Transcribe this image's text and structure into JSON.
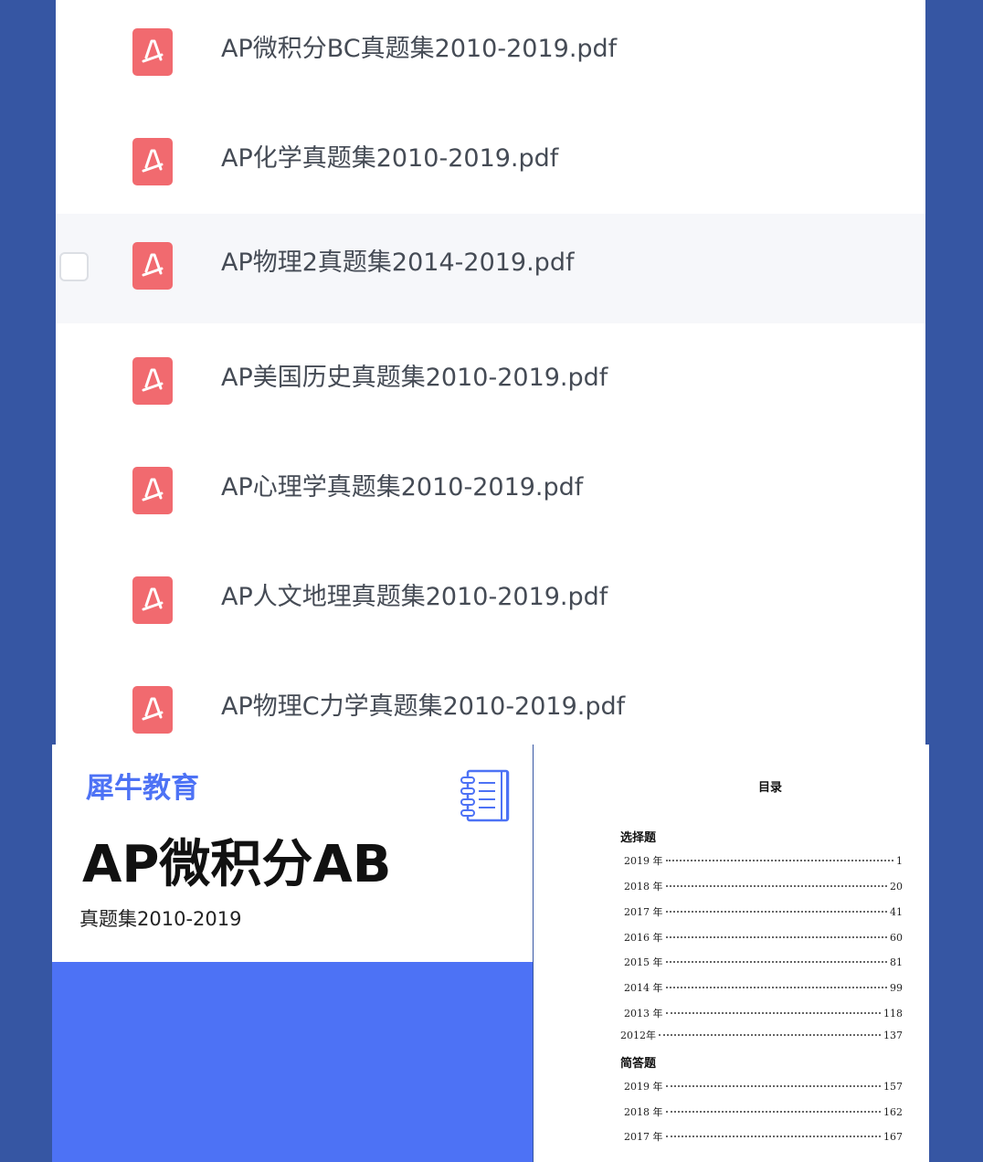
{
  "files": [
    {
      "name": "AP微积分BC真题集2010-2019.pdf",
      "icon": "pdf-icon"
    },
    {
      "name": "AP化学真题集2010-2019.pdf",
      "icon": "pdf-icon"
    },
    {
      "name": "AP物理2真题集2014-2019.pdf",
      "icon": "pdf-icon",
      "hovered": true
    },
    {
      "name": "AP美国历史真题集2010-2019.pdf",
      "icon": "pdf-icon"
    },
    {
      "name": "AP心理学真题集2010-2019.pdf",
      "icon": "pdf-icon"
    },
    {
      "name": "AP人文地理真题集2010-2019.pdf",
      "icon": "pdf-icon"
    },
    {
      "name": "AP物理C力学真题集2010-2019.pdf",
      "icon": "pdf-icon"
    }
  ],
  "cover": {
    "brand": "犀牛教育",
    "title": "AP微积分AB",
    "subtitle": "真题集2010-2019",
    "icon": "notebook-icon",
    "accent_color": "#4d72f5"
  },
  "toc": {
    "title": "目录",
    "sections": [
      {
        "heading": "选择题",
        "entries": [
          {
            "label": "2019 年",
            "page": "1"
          },
          {
            "label": "2018 年",
            "page": "20"
          },
          {
            "label": "2017 年",
            "page": "41"
          },
          {
            "label": "2016 年",
            "page": "60"
          },
          {
            "label": "2015 年",
            "page": "81"
          },
          {
            "label": "2014 年",
            "page": "99"
          },
          {
            "label": "2013 年",
            "page": "118"
          },
          {
            "label": "2012年",
            "page": "137"
          }
        ]
      },
      {
        "heading": "简答题",
        "entries": [
          {
            "label": "2019 年",
            "page": "157"
          },
          {
            "label": "2018 年",
            "page": "162"
          },
          {
            "label": "2017 年",
            "page": "167"
          }
        ]
      }
    ]
  },
  "colors": {
    "background": "#3656a3",
    "pdf_icon": "#f16a6f",
    "file_text": "#454b55"
  }
}
